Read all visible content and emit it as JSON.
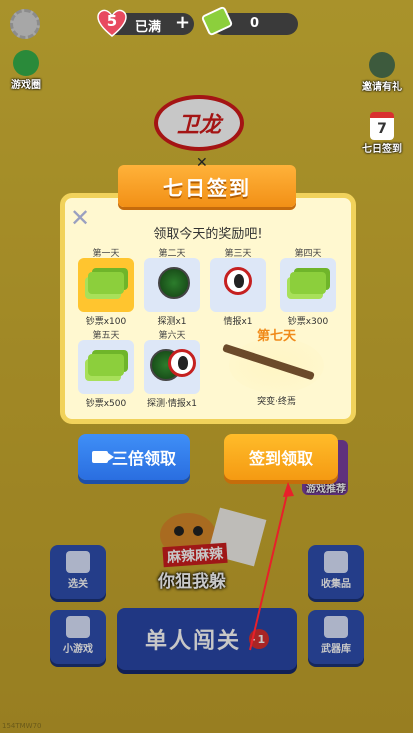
{
  "topbar": {
    "lives": "5",
    "lives_status": "已满",
    "add_symbol": "+",
    "cash": "0"
  },
  "side": {
    "left_top": "游戏圈",
    "right_top": "邀请有礼",
    "calendar_num": "7",
    "right_second": "七日签到"
  },
  "logo": {
    "text": "卫龙"
  },
  "modal": {
    "title": "七日签到",
    "subtitle": "领取今天的奖励吧!",
    "days": [
      {
        "label": "第一天",
        "reward": "钞票x100",
        "icon": "cash-icon",
        "active": true
      },
      {
        "label": "第二天",
        "reward": "探测x1",
        "icon": "radar-icon",
        "active": false
      },
      {
        "label": "第三天",
        "reward": "情报x1",
        "icon": "alien-icon",
        "active": false
      },
      {
        "label": "第四天",
        "reward": "钞票x300",
        "icon": "cash-icon",
        "active": false
      },
      {
        "label": "第五天",
        "reward": "钞票x500",
        "icon": "cash-icon",
        "active": false
      },
      {
        "label": "第六天",
        "reward": "探测·情报x1",
        "icon": "radar-alien-icon",
        "active": false
      }
    ],
    "day7": {
      "label": "第七天",
      "reward": "突变·终焉"
    }
  },
  "buttons": {
    "triple": "三倍领取",
    "claim": "签到领取"
  },
  "promo": {
    "line1": "麻辣麻辣",
    "line2": "你狙我躲",
    "card": "游戏推荐"
  },
  "menu": {
    "levels": "选关",
    "minigame": "小游戏",
    "collection": "收集品",
    "armory": "武器库",
    "single": "单人闯关",
    "heart_cost": "-1"
  },
  "version": "154TMW70"
}
